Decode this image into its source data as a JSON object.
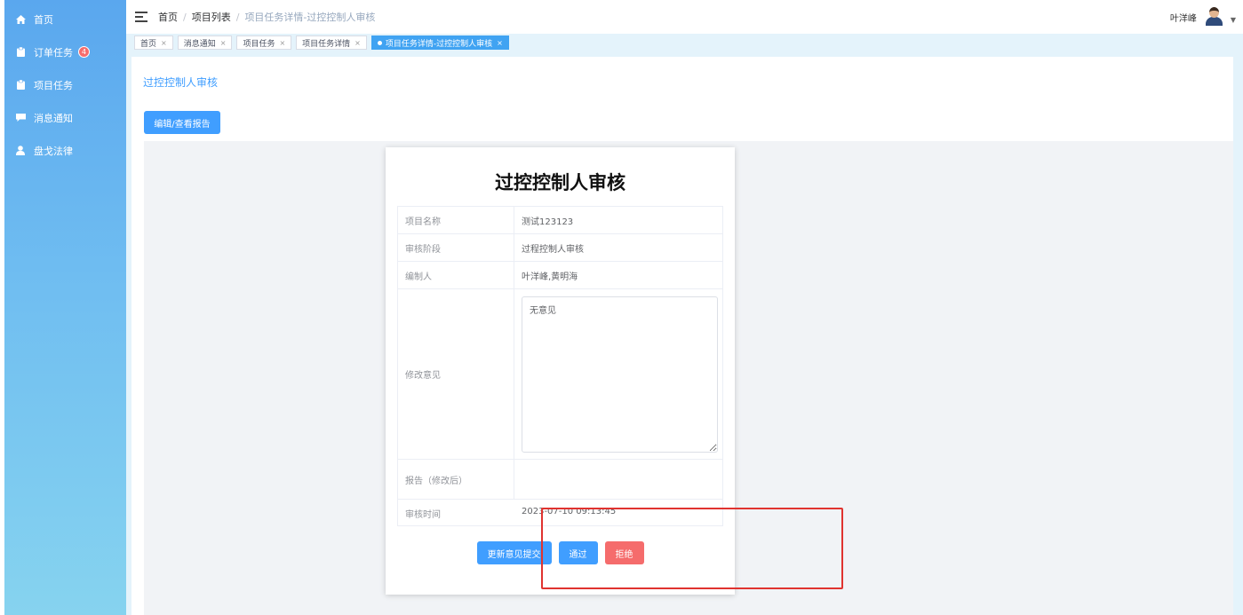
{
  "sidebar": {
    "items": [
      {
        "label": "首页",
        "icon": "home-icon"
      },
      {
        "label": "订单任务",
        "icon": "clipboard-icon",
        "badge": "4"
      },
      {
        "label": "项目任务",
        "icon": "clipboard-icon"
      },
      {
        "label": "消息通知",
        "icon": "message-icon"
      },
      {
        "label": "盘戈法律",
        "icon": "user-icon"
      }
    ]
  },
  "header": {
    "breadcrumb": [
      "首页",
      "项目列表",
      "项目任务详情-过控控制人审核"
    ],
    "user_name": "叶洋峰"
  },
  "tags": [
    {
      "label": "首页",
      "active": false
    },
    {
      "label": "消息通知",
      "active": false
    },
    {
      "label": "项目任务",
      "active": false
    },
    {
      "label": "项目任务详情",
      "active": false
    },
    {
      "label": "项目任务详情-过控控制人审核",
      "active": true
    }
  ],
  "main": {
    "page_title": "过控控制人审核",
    "edit_button": "编辑/查看报告"
  },
  "doc": {
    "title": "过控控制人审核",
    "rows": {
      "project_name": {
        "label": "项目名称",
        "value": "测试123123"
      },
      "stage": {
        "label": "审核阶段",
        "value": "过程控制人审核"
      },
      "editor": {
        "label": "编制人",
        "value": "叶洋峰,黄明海"
      },
      "opinion": {
        "label": "修改意见",
        "value": "无意见"
      },
      "report": {
        "label": "报告（修改后）",
        "value": ""
      },
      "review_time": {
        "label": "审核时间",
        "value": "2023-07-10 09:13:45"
      }
    },
    "buttons": {
      "submit": "更新意见提交",
      "approve": "通过",
      "reject": "拒绝"
    }
  },
  "colors": {
    "primary": "#409eff",
    "danger": "#f56c6c",
    "sidebar_top": "#5aa7ee",
    "sidebar_bottom": "#86d3ef",
    "highlight": "#e0332f"
  }
}
